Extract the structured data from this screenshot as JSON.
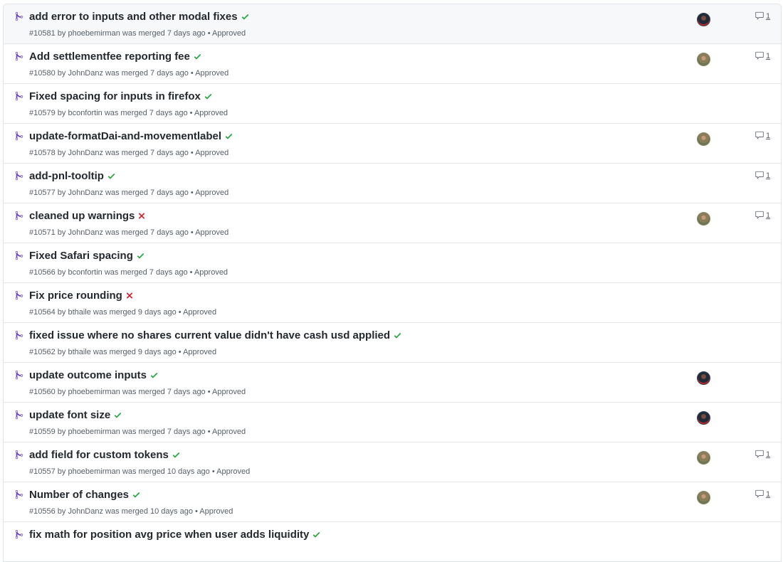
{
  "colors": {
    "merged": "#6f42c1",
    "success": "#28a745",
    "failure": "#cb2431",
    "muted": "#586069"
  },
  "pull_requests": [
    {
      "title": "add error to inputs and other modal fixes",
      "status": "success",
      "number": "#10581",
      "meta": "by phoebemirman was merged 7 days ago • Approved",
      "avatar": "dark",
      "comments": "1"
    },
    {
      "title": "Add settlementfee reporting fee",
      "status": "success",
      "number": "#10580",
      "meta": "by JohnDanz was merged 7 days ago • Approved",
      "avatar": "olive",
      "comments": "1"
    },
    {
      "title": "Fixed spacing for inputs in firefox",
      "status": "success",
      "number": "#10579",
      "meta": "by bconfortin was merged 7 days ago • Approved",
      "avatar": "",
      "comments": ""
    },
    {
      "title": "update-formatDai-and-movementlabel",
      "status": "success",
      "number": "#10578",
      "meta": "by JohnDanz was merged 7 days ago • Approved",
      "avatar": "olive",
      "comments": "1"
    },
    {
      "title": "add-pnl-tooltip",
      "status": "success",
      "number": "#10577",
      "meta": "by JohnDanz was merged 7 days ago • Approved",
      "avatar": "",
      "comments": "1"
    },
    {
      "title": "cleaned up warnings",
      "status": "failure",
      "number": "#10571",
      "meta": "by JohnDanz was merged 7 days ago • Approved",
      "avatar": "olive",
      "comments": "1"
    },
    {
      "title": "Fixed Safari spacing",
      "status": "success",
      "number": "#10566",
      "meta": "by bconfortin was merged 7 days ago • Approved",
      "avatar": "",
      "comments": ""
    },
    {
      "title": "Fix price rounding",
      "status": "failure",
      "number": "#10564",
      "meta": "by bthaile was merged 9 days ago • Approved",
      "avatar": "",
      "comments": ""
    },
    {
      "title": "fixed issue where no shares current value didn't have cash usd applied",
      "status": "success",
      "number": "#10562",
      "meta": "by bthaile was merged 9 days ago • Approved",
      "avatar": "",
      "comments": ""
    },
    {
      "title": "update outcome inputs",
      "status": "success",
      "number": "#10560",
      "meta": "by phoebemirman was merged 7 days ago • Approved",
      "avatar": "dark",
      "comments": ""
    },
    {
      "title": "update font size",
      "status": "success",
      "number": "#10559",
      "meta": "by phoebemirman was merged 7 days ago • Approved",
      "avatar": "dark",
      "comments": ""
    },
    {
      "title": "add field for custom tokens",
      "status": "success",
      "number": "#10557",
      "meta": "by phoebemirman was merged 10 days ago • Approved",
      "avatar": "olive",
      "comments": "1"
    },
    {
      "title": "Number of changes",
      "status": "success",
      "number": "#10556",
      "meta": "by JohnDanz was merged 10 days ago • Approved",
      "avatar": "olive",
      "comments": "1"
    },
    {
      "title": "fix math for position avg price when user adds liquidity",
      "status": "success",
      "number": "",
      "meta": "",
      "avatar": "",
      "comments": ""
    }
  ]
}
